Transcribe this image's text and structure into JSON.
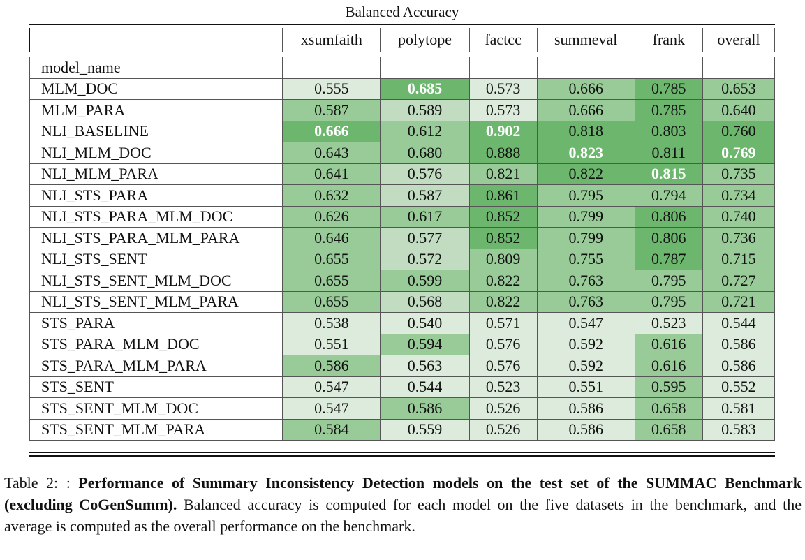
{
  "table": {
    "title": "Balanced Accuracy",
    "index_label": "model_name",
    "columns": [
      "xsumfaith",
      "polytope",
      "factcc",
      "summeval",
      "frank",
      "overall"
    ],
    "rows": [
      {
        "name": "MLM_DOC",
        "values": [
          "0.555",
          "0.685",
          "0.573",
          "0.666",
          "0.785",
          "0.653"
        ],
        "levels": [
          0,
          3,
          0,
          2,
          3,
          2
        ],
        "best": [
          false,
          true,
          false,
          false,
          false,
          false
        ]
      },
      {
        "name": "MLM_PARA",
        "values": [
          "0.587",
          "0.589",
          "0.573",
          "0.666",
          "0.785",
          "0.640"
        ],
        "levels": [
          2,
          1,
          0,
          2,
          3,
          2
        ],
        "best": [
          false,
          false,
          false,
          false,
          false,
          false
        ]
      },
      {
        "name": "NLI_BASELINE",
        "values": [
          "0.666",
          "0.612",
          "0.902",
          "0.818",
          "0.803",
          "0.760"
        ],
        "levels": [
          3,
          2,
          3,
          3,
          3,
          3
        ],
        "best": [
          true,
          false,
          true,
          false,
          false,
          false
        ]
      },
      {
        "name": "NLI_MLM_DOC",
        "values": [
          "0.643",
          "0.680",
          "0.888",
          "0.823",
          "0.811",
          "0.769"
        ],
        "levels": [
          2,
          2,
          3,
          3,
          3,
          3
        ],
        "best": [
          false,
          false,
          false,
          true,
          false,
          true
        ]
      },
      {
        "name": "NLI_MLM_PARA",
        "values": [
          "0.641",
          "0.576",
          "0.821",
          "0.822",
          "0.815",
          "0.735"
        ],
        "levels": [
          2,
          1,
          2,
          3,
          3,
          2
        ],
        "best": [
          false,
          false,
          false,
          false,
          true,
          false
        ]
      },
      {
        "name": "NLI_STS_PARA",
        "values": [
          "0.632",
          "0.587",
          "0.861",
          "0.795",
          "0.794",
          "0.734"
        ],
        "levels": [
          2,
          1,
          3,
          2,
          2,
          2
        ],
        "best": [
          false,
          false,
          false,
          false,
          false,
          false
        ]
      },
      {
        "name": "NLI_STS_PARA_MLM_DOC",
        "values": [
          "0.626",
          "0.617",
          "0.852",
          "0.799",
          "0.806",
          "0.740"
        ],
        "levels": [
          2,
          2,
          3,
          2,
          3,
          2
        ],
        "best": [
          false,
          false,
          false,
          false,
          false,
          false
        ]
      },
      {
        "name": "NLI_STS_PARA_MLM_PARA",
        "values": [
          "0.646",
          "0.577",
          "0.852",
          "0.799",
          "0.806",
          "0.736"
        ],
        "levels": [
          2,
          1,
          3,
          2,
          3,
          2
        ],
        "best": [
          false,
          false,
          false,
          false,
          false,
          false
        ]
      },
      {
        "name": "NLI_STS_SENT",
        "values": [
          "0.655",
          "0.572",
          "0.809",
          "0.755",
          "0.787",
          "0.715"
        ],
        "levels": [
          2,
          1,
          2,
          2,
          3,
          2
        ],
        "best": [
          false,
          false,
          false,
          false,
          false,
          false
        ]
      },
      {
        "name": "NLI_STS_SENT_MLM_DOC",
        "values": [
          "0.655",
          "0.599",
          "0.822",
          "0.763",
          "0.795",
          "0.727"
        ],
        "levels": [
          2,
          2,
          2,
          2,
          2,
          2
        ],
        "best": [
          false,
          false,
          false,
          false,
          false,
          false
        ]
      },
      {
        "name": "NLI_STS_SENT_MLM_PARA",
        "values": [
          "0.655",
          "0.568",
          "0.822",
          "0.763",
          "0.795",
          "0.721"
        ],
        "levels": [
          2,
          1,
          2,
          2,
          2,
          2
        ],
        "best": [
          false,
          false,
          false,
          false,
          false,
          false
        ]
      },
      {
        "name": "STS_PARA",
        "values": [
          "0.538",
          "0.540",
          "0.571",
          "0.547",
          "0.523",
          "0.544"
        ],
        "levels": [
          0,
          0,
          0,
          0,
          0,
          0
        ],
        "best": [
          false,
          false,
          false,
          false,
          false,
          false
        ]
      },
      {
        "name": "STS_PARA_MLM_DOC",
        "values": [
          "0.551",
          "0.594",
          "0.576",
          "0.592",
          "0.616",
          "0.586"
        ],
        "levels": [
          0,
          2,
          0,
          0,
          2,
          0
        ],
        "best": [
          false,
          false,
          false,
          false,
          false,
          false
        ]
      },
      {
        "name": "STS_PARA_MLM_PARA",
        "values": [
          "0.586",
          "0.563",
          "0.576",
          "0.592",
          "0.616",
          "0.586"
        ],
        "levels": [
          2,
          0,
          0,
          0,
          2,
          0
        ],
        "best": [
          false,
          false,
          false,
          false,
          false,
          false
        ]
      },
      {
        "name": "STS_SENT",
        "values": [
          "0.547",
          "0.544",
          "0.523",
          "0.551",
          "0.595",
          "0.552"
        ],
        "levels": [
          0,
          0,
          0,
          0,
          2,
          0
        ],
        "best": [
          false,
          false,
          false,
          false,
          false,
          false
        ]
      },
      {
        "name": "STS_SENT_MLM_DOC",
        "values": [
          "0.547",
          "0.586",
          "0.526",
          "0.586",
          "0.658",
          "0.581"
        ],
        "levels": [
          0,
          2,
          0,
          0,
          2,
          0
        ],
        "best": [
          false,
          false,
          false,
          false,
          false,
          false
        ]
      },
      {
        "name": "STS_SENT_MLM_PARA",
        "values": [
          "0.584",
          "0.559",
          "0.526",
          "0.586",
          "0.658",
          "0.583"
        ],
        "levels": [
          2,
          0,
          0,
          0,
          2,
          0
        ],
        "best": [
          false,
          false,
          false,
          false,
          false,
          false
        ]
      }
    ]
  },
  "caption": {
    "prefix": "Table 2: : ",
    "bold": "Performance of Summary Inconsistency Detection models on the test set of the SUMMAC Benchmark (excluding CoGenSumm).",
    "rest": " Balanced accuracy is computed for each model on the five datasets in the benchmark, and the average is computed as the overall performance on the benchmark."
  },
  "colors": {
    "level0": "#dcebdb",
    "level1": "#c2dcc2",
    "level2": "#99cb99",
    "level3": "#6db66e",
    "best_text": "#ffffff"
  }
}
